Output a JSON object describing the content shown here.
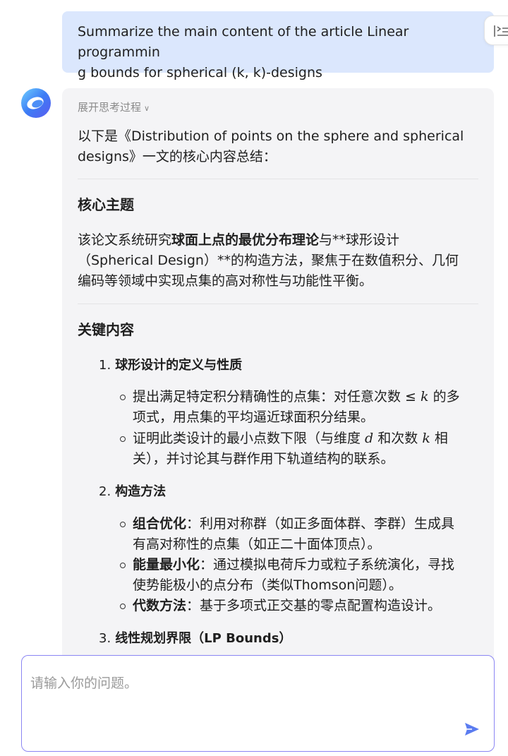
{
  "user_message": {
    "line1": "Summarize the main content of the article Linear programmin",
    "line2": "g bounds for spherical (k, k)-designs"
  },
  "answer": {
    "thinking_toggle": "展开思考过程",
    "intro": {
      "line1": "以下是《Distribution of points on the sphere and spherical",
      "line2": "designs》一文的核心内容总结："
    },
    "section1": {
      "title": "核心主题",
      "l1_a": "该论文系统研究",
      "l1_bold": "球面上点的最优分布理论",
      "l1_b": "与**球形设计",
      "line2": "（Spherical Design）**的构造方法，聚焦于在数值积分、几何",
      "line3": "编码等领域中实现点集的高对称性与功能性平衡。"
    },
    "section2": {
      "title": "关键内容",
      "items": [
        {
          "num": "1.",
          "title": "球形设计的定义与性质",
          "bullets": [
            {
              "a1": "提出满足特定积分精确性的点集：对任意次数 ≤ ",
              "m1": "k",
              "a2": " 的多",
              "b": "项式，用点集的平均逼近球面积分结果。"
            },
            {
              "a1": "证明此类设计的最小点数下限（与维度 ",
              "m1": "d",
              "a2": " 和次数 ",
              "m2": "k",
              "a3": " 相",
              "b": "关），并讨论其与群作用下轨道结构的联系。"
            }
          ]
        },
        {
          "num": "2.",
          "title": "构造方法",
          "bullets": [
            {
              "bold": "组合优化",
              "a1": "：利用对称群（如正多面体群、李群）生成具",
              "b": "有高对称性的点集（如正二十面体顶点）。"
            },
            {
              "bold": "能量最小化",
              "a1": "：通过模拟电荷斥力或粒子系统演化，寻找",
              "b": "使势能极小的点分布（类似Thomson问题）。"
            },
            {
              "bold": "代数方法",
              "a1": "：基于多项式正交基的零点配置构造设计。"
            }
          ]
        },
        {
          "num": "3.",
          "title": "线性规划界限（LP Bounds）"
        }
      ]
    }
  },
  "input": {
    "placeholder": "请输入你的问题。"
  },
  "icons": {
    "outline": "outline-list-icon",
    "avatar": "assistant-logo-icon",
    "send": "send-icon"
  },
  "colors": {
    "user_bubble": "#dbe7fd",
    "answer_bg": "#f4f4f6",
    "input_border": "#8b86f3",
    "send": "#5b7cf0"
  }
}
